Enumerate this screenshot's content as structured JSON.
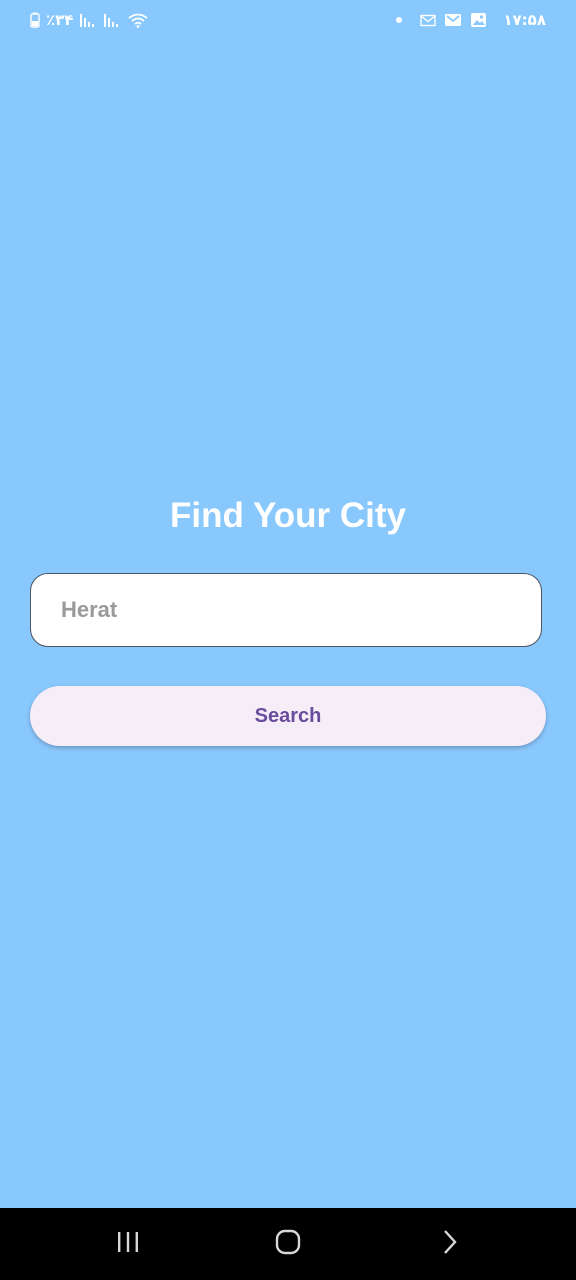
{
  "status_bar": {
    "battery_percent": "٪۳۴",
    "time": "۱۷:۵۸",
    "icons_left": [
      "battery-icon",
      "signal-icon-1",
      "signal-icon-2",
      "wifi-icon"
    ],
    "icons_right": [
      "notification-dot-icon",
      "mail-outline-icon",
      "gmail-icon",
      "gallery-icon"
    ]
  },
  "main": {
    "title": "Find Your City",
    "city_input": {
      "value": "",
      "placeholder": "Herat"
    },
    "search_button_label": "Search"
  },
  "nav_bar": {
    "buttons": [
      "recent-apps-icon",
      "home-icon",
      "back-icon"
    ]
  },
  "colors": {
    "background": "#89c8fd",
    "title_text": "#ffffff",
    "button_bg": "#f5eef9",
    "button_text": "#6a4c9c",
    "input_border": "#4e5462",
    "nav_bar": "#000000"
  }
}
